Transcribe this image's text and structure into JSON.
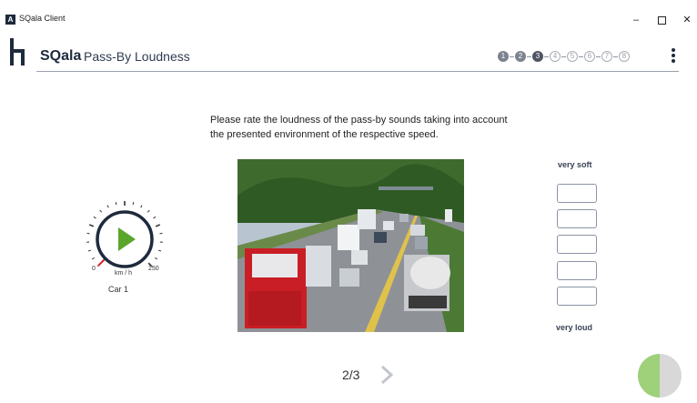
{
  "window": {
    "title": "SQala Client",
    "icon_letter": "A",
    "minimize": "–",
    "close": "✕"
  },
  "header": {
    "brand": "SQala",
    "page_title": "Pass-By Loudness",
    "steps": [
      {
        "label": "1",
        "state": "done"
      },
      {
        "label": "2",
        "state": "done"
      },
      {
        "label": "3",
        "state": "current"
      },
      {
        "label": "4",
        "state": "todo"
      },
      {
        "label": "5",
        "state": "todo"
      },
      {
        "label": "6",
        "state": "todo"
      },
      {
        "label": "7",
        "state": "todo"
      },
      {
        "label": "8",
        "state": "todo"
      }
    ]
  },
  "instruction": "Please rate the loudness of the pass-by sounds taking into account the presented environment of the respective speed.",
  "gauge": {
    "min": "0",
    "max": "250",
    "unit": "km / h",
    "label": "Car 1",
    "accent": "#4aa02c"
  },
  "rating": {
    "top_label": "very soft",
    "bottom_label": "very loud",
    "options": 5
  },
  "pager": {
    "text": "2/3"
  },
  "colors": {
    "play_green": "#5aa62c",
    "timer_green": "#9fd07a",
    "timer_grey": "#d8d8d8"
  }
}
